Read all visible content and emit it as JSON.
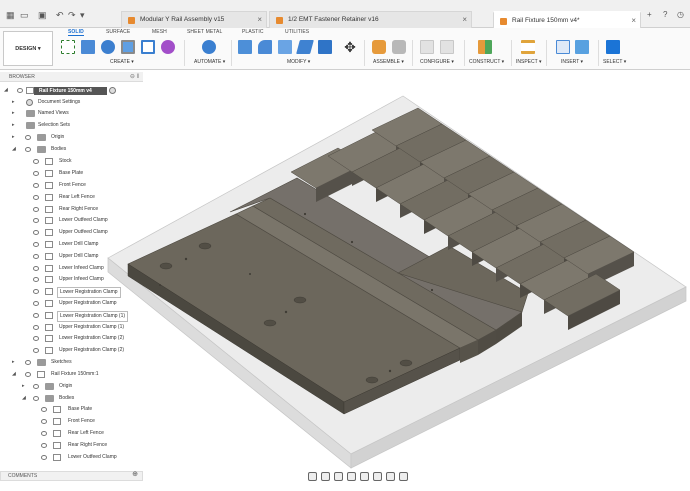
{
  "tabs": [
    {
      "label": "Modular Y Rail Assembly v15"
    },
    {
      "label": "1/2 EMT Fastener Retainer v16"
    },
    {
      "label": "Rail Fixture 150mm v4*"
    }
  ],
  "ribbon": {
    "design_label": "DESIGN",
    "tabs": [
      "SOLID",
      "SURFACE",
      "MESH",
      "SHEET METAL",
      "PLASTIC",
      "UTILITIES"
    ],
    "groups": [
      "CREATE",
      "AUTOMATE",
      "MODIFY",
      "ASSEMBLE",
      "CONFIGURE",
      "CONSTRUCT",
      "INSPECT",
      "INSERT",
      "SELECT"
    ]
  },
  "browser": {
    "title": "BROWSER",
    "root": "Rail Fixture 150mm v4",
    "top_items": [
      "Document Settings",
      "Named Views",
      "Selection Sets",
      "Origin",
      "Bodies"
    ],
    "bodies": [
      "Stock",
      "Base Plate",
      "Front Fence",
      "Rear Left Fence",
      "Rear Right Fence",
      "Lower Outfeed Clamp",
      "Upper Outfeed Clamp",
      "Lower Drill Clamp",
      "Upper Drill Clamp",
      "Lower Infeed Clamp",
      "Upper Infeed Clamp",
      "Lower Registration Clamp",
      "Upper Registration Clamp",
      "Lower Registration Clamp (1)",
      "Upper Registration Clamp (1)",
      "Lower Registration Clamp (2)",
      "Upper Registration Clamp (2)"
    ],
    "sketches": "Sketches",
    "component": "Rail Fixture 150mm:1",
    "comp_items": [
      "Origin",
      "Bodies"
    ],
    "comp_bodies": [
      "Base Plate",
      "Front Fence",
      "Rear Left Fence",
      "Rear Right Fence",
      "Lower Outfeed Clamp"
    ]
  },
  "comments": {
    "label": "COMMENTS"
  },
  "colors": {
    "accent": "#1a6fd1",
    "body_dark": "#5e5a50",
    "body_mid": "#6f6b62",
    "body_light": "#8a857a"
  }
}
